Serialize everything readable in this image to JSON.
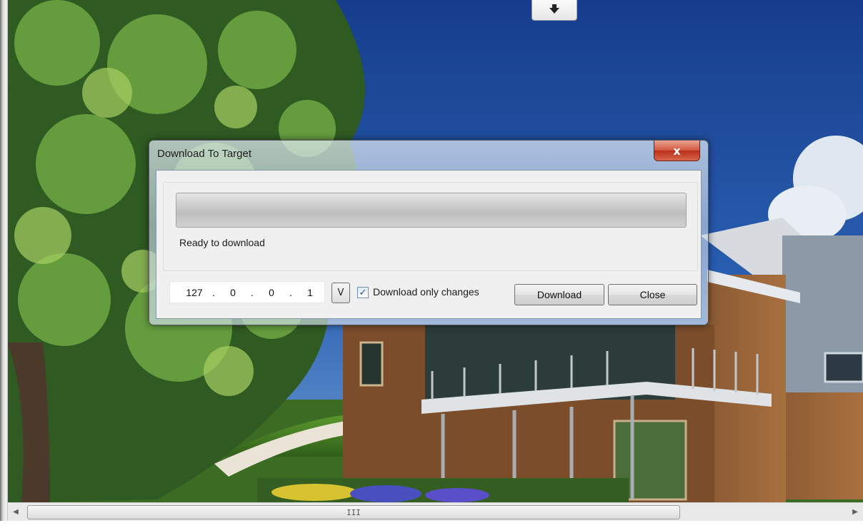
{
  "dialog": {
    "title": "Download To Target",
    "close_glyph": "x",
    "progress": 0,
    "status_text": "Ready to download",
    "ip": {
      "o1": "127",
      "o2": "0",
      "o3": "0",
      "o4": "1",
      "sep": "."
    },
    "v_button_label": "V",
    "checkbox": {
      "label": "Download only changes",
      "checked": true,
      "check_glyph": "✓"
    },
    "download_button": "Download",
    "close_button": "Close"
  },
  "scrollbar": {
    "left_arrow": "◀",
    "right_arrow": "▶",
    "grip": "III"
  },
  "icons": {
    "top_toggle": "arrow-down-icon"
  },
  "colors": {
    "sky": "#1d4a9c",
    "dialog_close": "#c7432b"
  }
}
